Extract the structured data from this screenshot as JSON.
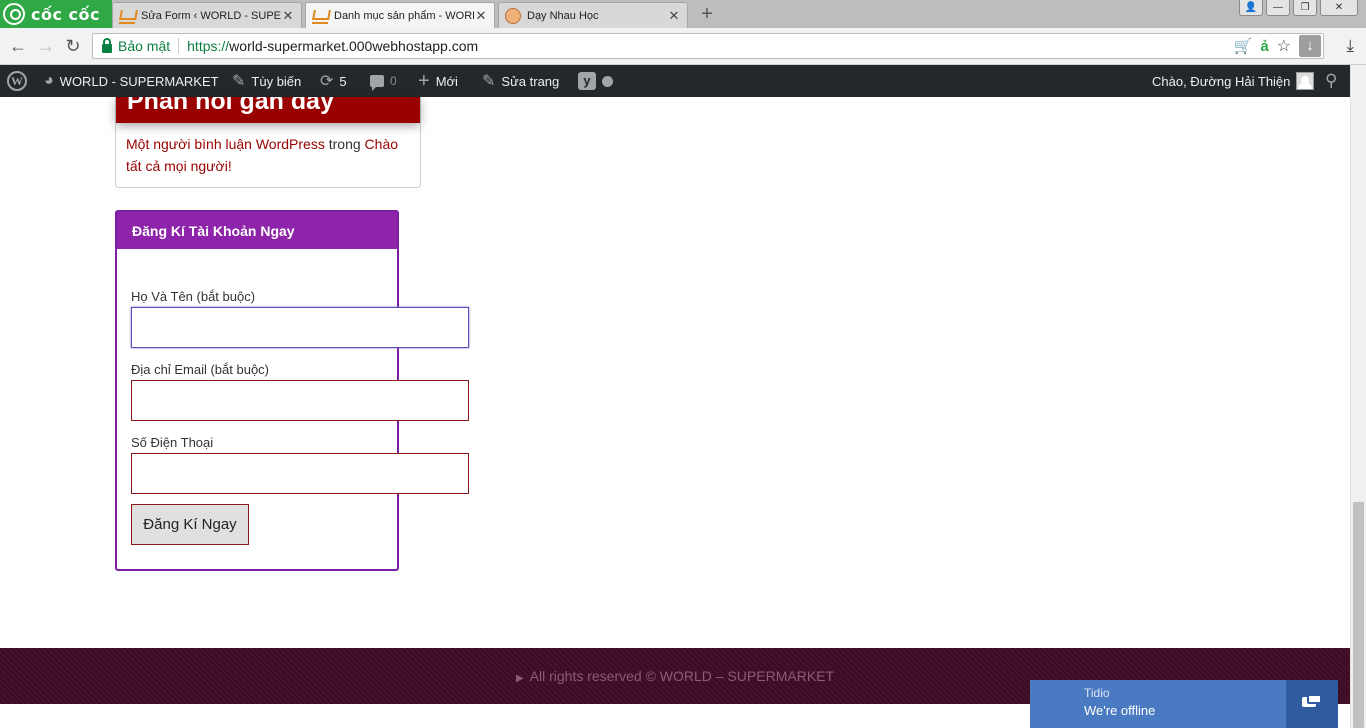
{
  "browser": {
    "brand": "cốc cốc",
    "tabs": [
      {
        "title": "Sửa Form ‹ WORLD - SUPERMARKET",
        "close": "✕"
      },
      {
        "title": "Danh mục sản phẩm - WORLD - SUPERMARKET",
        "close": "✕"
      },
      {
        "title": "Dạy Nhau Học",
        "close": "✕"
      }
    ],
    "new_tab": "+",
    "security_label": "Bảo mật",
    "url_scheme": "https://",
    "url_host": "world-supermarket.000webhostapp.com",
    "win_buttons": {
      "user": "👤",
      "minimize": "—",
      "restore": "❐",
      "close": "✕"
    },
    "icons": {
      "back": "arrow-left-icon",
      "forward": "arrow-right-icon",
      "reload": "reload-icon",
      "cart": "cart-icon",
      "translate": "translate-icon",
      "star": "star-icon",
      "download": "download-icon"
    }
  },
  "admin_bar": {
    "site_name": "WORLD - SUPERMARKET",
    "customize": "Tùy biến",
    "updates_count": "5",
    "comments_count": "0",
    "new_label": "Mới",
    "edit_page": "Sửa trang",
    "greeting": "Chào, Đường Hải Thiện"
  },
  "comments_widget": {
    "title": "Phản hồi gần đây",
    "author": "Một người bình luận WordPress",
    "connector": "trong",
    "post_link": "Chào tất cả mọi người!"
  },
  "register_widget": {
    "title": "Đăng Kí Tài Khoản Ngay",
    "name_label": "Họ Và Tên (bắt buộc)",
    "name_value": "",
    "email_label": "Địa chỉ Email (bắt buộc)",
    "email_value": "",
    "phone_label": "Số Điện Thoại",
    "phone_value": "",
    "submit_label": "Đăng Kí Ngay"
  },
  "footer": {
    "text": "All rights reserved © WORLD – SUPERMARKET",
    "marker": "▶"
  },
  "tidio": {
    "brand": "Tidio",
    "status": "We're offline"
  },
  "colors": {
    "wp_admin_bar": "#23282d",
    "widget_header_red": "#990000",
    "register_purple": "#8e24aa",
    "footer_bg": "#3d0a24",
    "tidio_blue": "#4a7bc2",
    "brand_green": "#2fa845"
  }
}
